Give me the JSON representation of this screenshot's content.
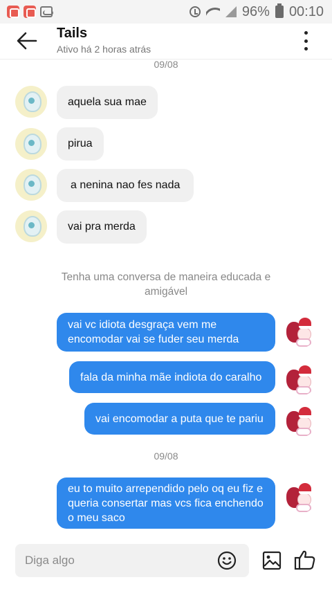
{
  "status_bar": {
    "battery": "96%",
    "time": "00:10"
  },
  "header": {
    "name": "Tails",
    "status": "Ativo há 2 horas atrás"
  },
  "dates": [
    "09/08",
    "09/08"
  ],
  "incoming": [
    "aquela sua mae",
    "pirua",
    "a nenina nao fes nada",
    "vai pra merda"
  ],
  "notice": "Tenha uma conversa de maneira educada e amigável",
  "outgoing": [
    "vai vc idiota desgraça vem me encomodar vai se fuder seu merda",
    "fala da minha mãe indiota do caralho",
    "vai encomodar a puta que te pariu",
    "eu to muito arrependido pelo oq eu fiz e queria consertar mas vcs fica enchendo o meu saco"
  ],
  "composer": {
    "placeholder": "Diga algo"
  },
  "colors": {
    "outgoing_bubble": "#2f88ec",
    "incoming_bubble": "#f0f0f0"
  },
  "icons": [
    "back-arrow-icon",
    "more-vertical-icon",
    "emoji-icon",
    "image-icon",
    "thumbs-up-icon",
    "alarm-icon",
    "wifi-icon",
    "signal-icon",
    "battery-icon"
  ]
}
